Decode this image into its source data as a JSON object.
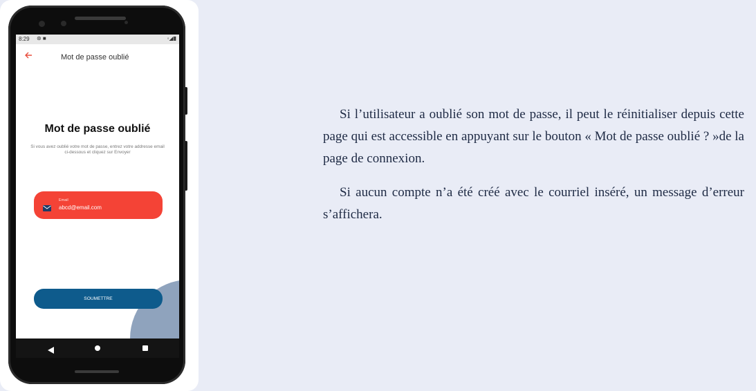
{
  "phone": {
    "status_bar": {
      "time": "8:29",
      "left_icons": "⊛ ■",
      "right_icons": "◦◢▮"
    },
    "app_bar": {
      "back_icon": "arrow-left-icon",
      "title": "Mot de passe oublié"
    },
    "screen": {
      "heading": "Mot de passe oublié",
      "description": "Si vous avez oublié votre mot de passe, entrez votre addresse email ci-dessous et cliquez sur Envoyer",
      "email_field": {
        "label": "Email",
        "value": "abcd@email.com",
        "icon": "mail-icon"
      },
      "submit_label": "SOUMETTRE"
    },
    "colors": {
      "accent_red": "#f44336",
      "button_blue": "#0e5b8c",
      "decor_blue": "#8fa3bd"
    }
  },
  "description_text": {
    "paragraph1": "Si l’utilisateur a oublié son mot de passe, il peut le réinitialiser depuis cette page qui est accessible en appuyant sur le bouton « Mot de passe oublié ? »de la page de connexion.",
    "paragraph2": "Si aucun compte n’a été créé avec le courriel inséré, un message d’erreur s’affichera."
  }
}
